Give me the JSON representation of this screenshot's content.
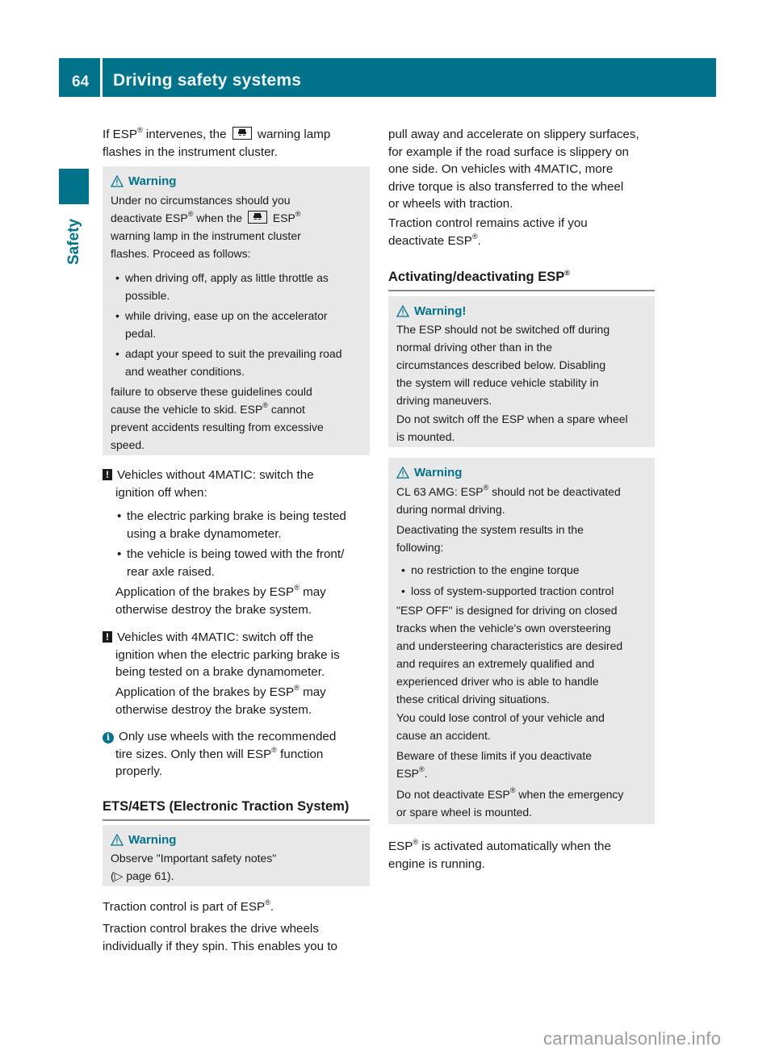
{
  "header": {
    "page_number": "64",
    "title": "Driving safety systems"
  },
  "side_tab": {
    "label": "Safety"
  },
  "left": {
    "intro": [
      "If ESP",
      "®",
      " intervenes, the ",
      "[esp-lamp-icon]",
      " warning lamp flashes in the instrument cluster."
    ],
    "intro_a": "If ESP",
    "intro_b": " intervenes, the",
    "intro_c": "warning lamp",
    "intro_d": "flashes in the instrument cluster.",
    "warning1": {
      "title": "Warning",
      "l1": "Under no circumstances should you",
      "l2a": "deactivate ESP",
      "l2b": " when the",
      "l2c": "ESP",
      "l3": "warning lamp in the instrument cluster",
      "l4": "flashes. Proceed as follows:",
      "bullets": [
        [
          "when driving off, apply as little throttle as",
          "possible."
        ],
        [
          "while driving, ease up on the accelerator",
          "pedal."
        ],
        [
          "adapt your speed to suit the prevailing road",
          "and weather conditions."
        ]
      ],
      "f1": "failure to observe these guidelines could",
      "f2a": "cause the vehicle to skid. ESP",
      "f2b": " cannot",
      "f3": "prevent accidents resulting from excessive",
      "f4": "speed."
    },
    "note1": {
      "l1": "Vehicles without 4MATIC: switch the",
      "l2": "ignition off when:",
      "bullets": [
        [
          "the electric parking brake is being tested",
          "using a brake dynamometer."
        ],
        [
          "the vehicle is being towed with the front/",
          "rear axle raised."
        ]
      ],
      "a1a": "Application of the brakes by ESP",
      "a1b": " may",
      "a2": "otherwise destroy the brake system."
    },
    "note2": {
      "l1": "Vehicles with 4MATIC: switch off the",
      "l2": "ignition when the electric parking brake is",
      "l3": "being tested on a brake dynamometer.",
      "a1a": "Application of the brakes by ESP",
      "a1b": " may",
      "a2": "otherwise destroy the brake system."
    },
    "info": {
      "l1": "Only use wheels with the recommended",
      "l2a": "tire sizes. Only then will ESP",
      "l2b": " function",
      "l3": "properly."
    },
    "ets_heading": "ETS/4ETS (Electronic Traction System)",
    "warning2": {
      "title": "Warning",
      "l1": "Observe \"Important safety notes\"",
      "l2": "(▷ page 61)."
    },
    "t1a": "Traction control is part of ESP",
    "t1b": ".",
    "t2": "Traction control brakes the drive wheels",
    "t3": "individually if they spin. This enables you to"
  },
  "right": {
    "p1": [
      "pull away and accelerate on slippery surfaces,",
      "for example if the road surface is slippery on",
      "one side. On vehicles with 4MATIC, more",
      "drive torque is also transferred to the wheel",
      "or wheels with traction."
    ],
    "p2a": "Traction control remains active if you",
    "p2b": "deactivate ESP",
    "p2c": ".",
    "heading": "Activating/deactivating ESP",
    "warning3": {
      "title": "Warning!",
      "lines": [
        "The ESP should not be switched off during",
        "normal driving other than in the",
        "circumstances described below. Disabling",
        "the system will reduce vehicle stability in",
        "driving maneuvers."
      ],
      "l2": [
        "Do not switch off the ESP when a spare wheel",
        "is mounted."
      ]
    },
    "warning4": {
      "title": "Warning",
      "l1a": "CL 63 AMG: ESP",
      "l1b": " should not be deactivated",
      "l2": "during normal driving.",
      "l3": "Deactivating the system results in the",
      "l4": "following:",
      "bullets": [
        "no restriction to the engine torque",
        "loss of system-supported traction control"
      ],
      "p": [
        "\"ESP OFF\" is designed for driving on closed",
        "tracks when the vehicle's own oversteering",
        "and understeering characteristics are desired",
        "and requires an extremely qualified and",
        "experienced driver who is able to handle",
        "these critical driving situations."
      ],
      "q": [
        "You could lose control of your vehicle and",
        "cause an accident."
      ],
      "r1": "Beware of these limits if you deactivate",
      "r2a": "ESP",
      "r2b": ".",
      "s1a": "Do not deactivate ESP",
      "s1b": " when the emergency",
      "s2": "or spare wheel is mounted."
    },
    "end1a": "ESP",
    "end1b": " is activated automatically when the",
    "end2": "engine is running."
  },
  "reg": "®",
  "watermark": "carmanualsonline.info"
}
